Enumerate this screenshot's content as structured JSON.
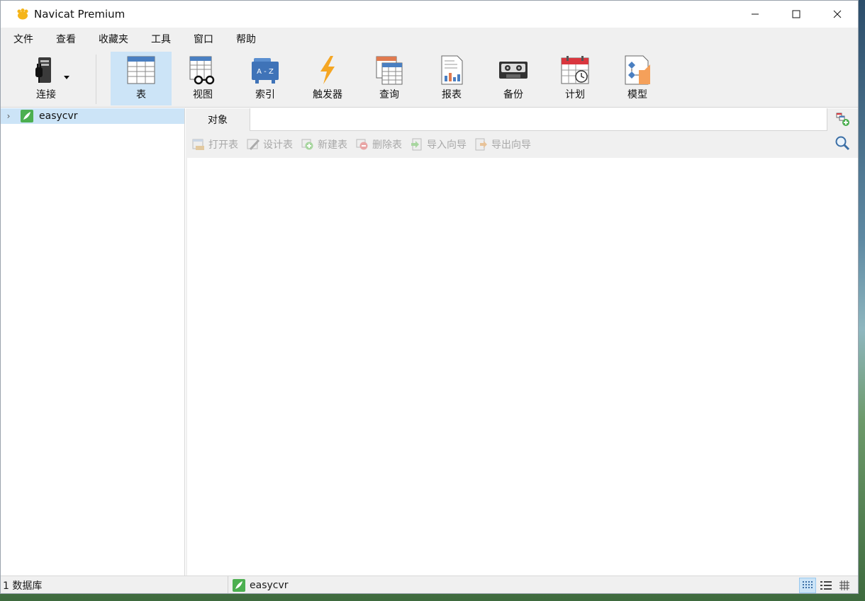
{
  "window": {
    "title": "Navicat Premium"
  },
  "menu": {
    "items": [
      "文件",
      "查看",
      "收藏夹",
      "工具",
      "窗口",
      "帮助"
    ]
  },
  "toolbar": {
    "connect_label": "连接",
    "buttons": [
      {
        "label": "表",
        "icon": "table-icon",
        "active": true
      },
      {
        "label": "视图",
        "icon": "view-icon"
      },
      {
        "label": "索引",
        "icon": "index-icon"
      },
      {
        "label": "触发器",
        "icon": "trigger-icon"
      },
      {
        "label": "查询",
        "icon": "query-icon"
      },
      {
        "label": "报表",
        "icon": "report-icon"
      },
      {
        "label": "备份",
        "icon": "backup-icon"
      },
      {
        "label": "计划",
        "icon": "schedule-icon"
      },
      {
        "label": "模型",
        "icon": "model-icon"
      }
    ]
  },
  "tree": {
    "connection": "easycvr"
  },
  "objects": {
    "tab_label": "对象",
    "actions": [
      "打开表",
      "设计表",
      "新建表",
      "删除表",
      "导入向导",
      "导出向导"
    ]
  },
  "status": {
    "count": "1 数据库",
    "connection": "easycvr"
  },
  "colors": {
    "selection": "#cce4f7",
    "chrome": "#f0f0f0",
    "db_icon": "#4caf50"
  }
}
